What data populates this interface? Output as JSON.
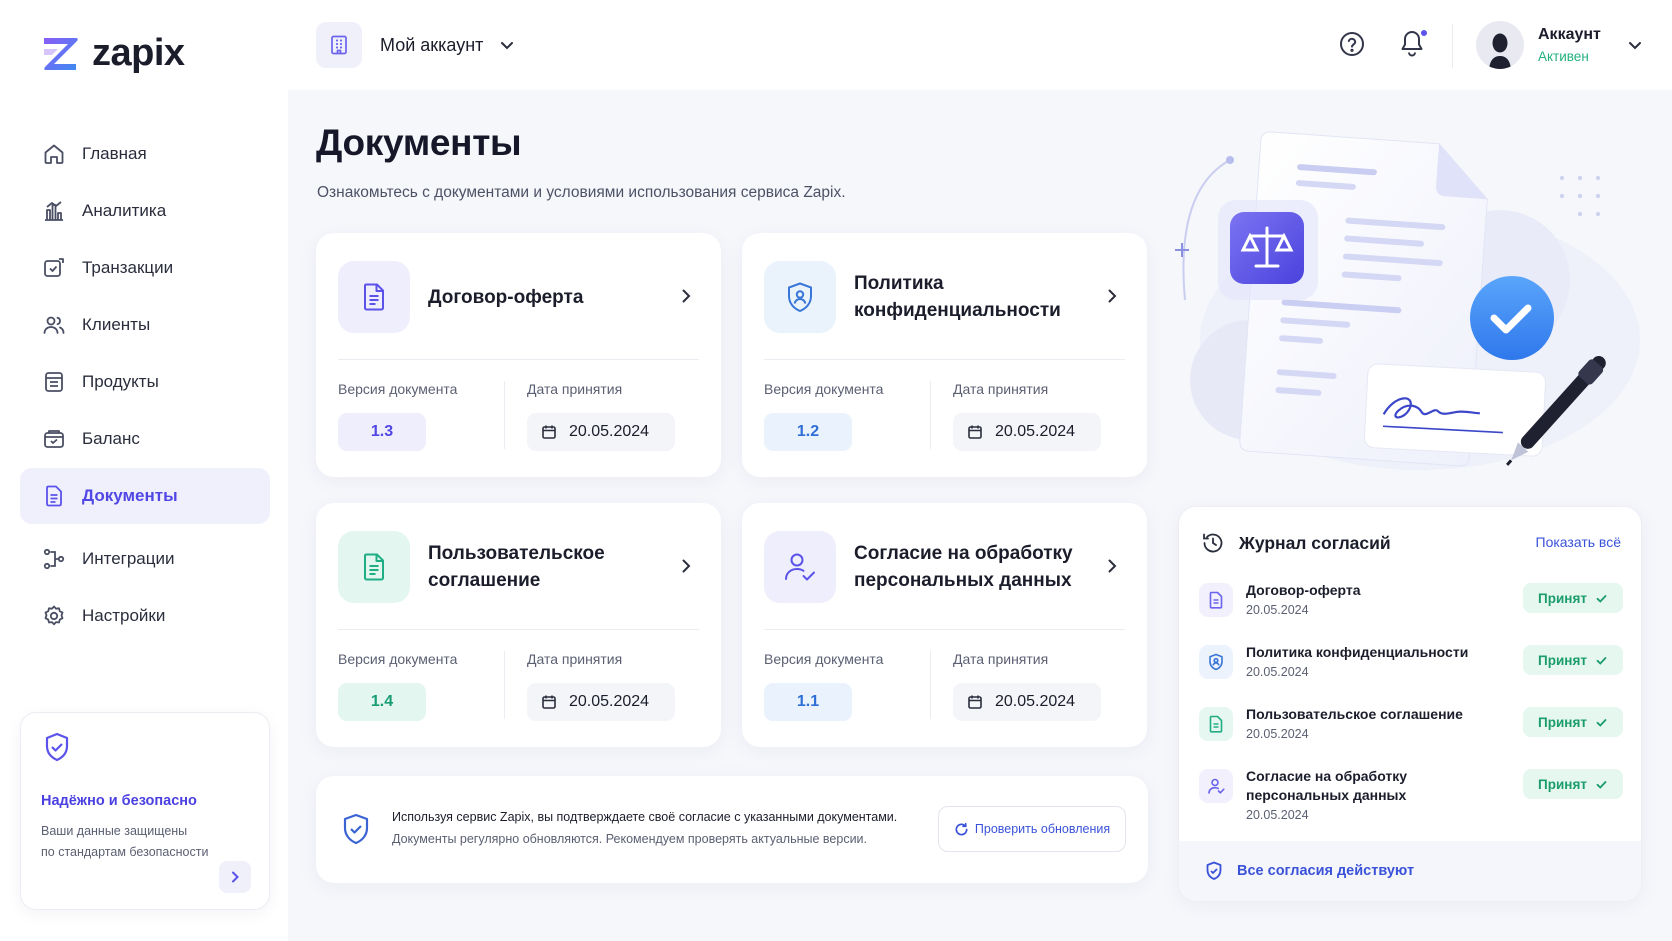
{
  "brand": {
    "name": "zapix"
  },
  "sidebar": {
    "items": [
      {
        "label": "Главная",
        "icon": "home-icon"
      },
      {
        "label": "Аналитика",
        "icon": "analytics-icon"
      },
      {
        "label": "Транзакции",
        "icon": "transactions-icon"
      },
      {
        "label": "Клиенты",
        "icon": "users-icon"
      },
      {
        "label": "Продукты",
        "icon": "products-icon"
      },
      {
        "label": "Баланс",
        "icon": "wallet-icon"
      },
      {
        "label": "Документы",
        "icon": "document-icon",
        "active": true
      },
      {
        "label": "Интеграции",
        "icon": "integrations-icon"
      },
      {
        "label": "Настройки",
        "icon": "gear-icon"
      }
    ],
    "secure": {
      "title": "Надёжно и безопасно",
      "line1": "Ваши данные защищены",
      "line2": "по стандартам безопасности"
    }
  },
  "header": {
    "account_label": "Мой аккаунт",
    "user_name": "Аккаунт",
    "user_status": "Активен"
  },
  "main": {
    "title": "Документы",
    "subtitle": "Ознакомьтесь с документами и условиями использования сервиса Zapix.",
    "version_label": "Версия документа",
    "date_label": "Дата принятия",
    "documents": [
      {
        "name": "Договор-оферта",
        "version": "1.3",
        "date": "20.05.2024",
        "accent": "violet"
      },
      {
        "name": "Политика конфиденциальности",
        "version": "1.2",
        "date": "20.05.2024",
        "accent": "blue"
      },
      {
        "name": "Пользовательское соглашение",
        "version": "1.4",
        "date": "20.05.2024",
        "accent": "green"
      },
      {
        "name": "Согласие на обработку персональных данных",
        "version": "1.1",
        "date": "20.05.2024",
        "accent": "violet"
      }
    ],
    "notice": {
      "main": "Используя сервис Zapix, вы подтверждаете своё согласие с указанными документами.",
      "sub": "Документы регулярно обновляются. Рекомендуем проверять актуальные версии.",
      "button": "Проверить обновления"
    }
  },
  "journal": {
    "title": "Журнал согласий",
    "show_all": "Показать всё",
    "entries": [
      {
        "name": "Договор-оферта",
        "date": "20.05.2024",
        "status": "Принят"
      },
      {
        "name": "Политика конфиденциальности",
        "date": "20.05.2024",
        "status": "Принят"
      },
      {
        "name": "Пользовательское соглашение",
        "date": "20.05.2024",
        "status": "Принят"
      },
      {
        "name": "Согласие на обработку персональных данных",
        "date": "20.05.2024",
        "status": "Принят"
      }
    ],
    "footer": "Все согласия действуют"
  },
  "colors": {
    "accent": "#5b52ea",
    "success": "#1a9c6c",
    "link": "#3a52d8"
  }
}
